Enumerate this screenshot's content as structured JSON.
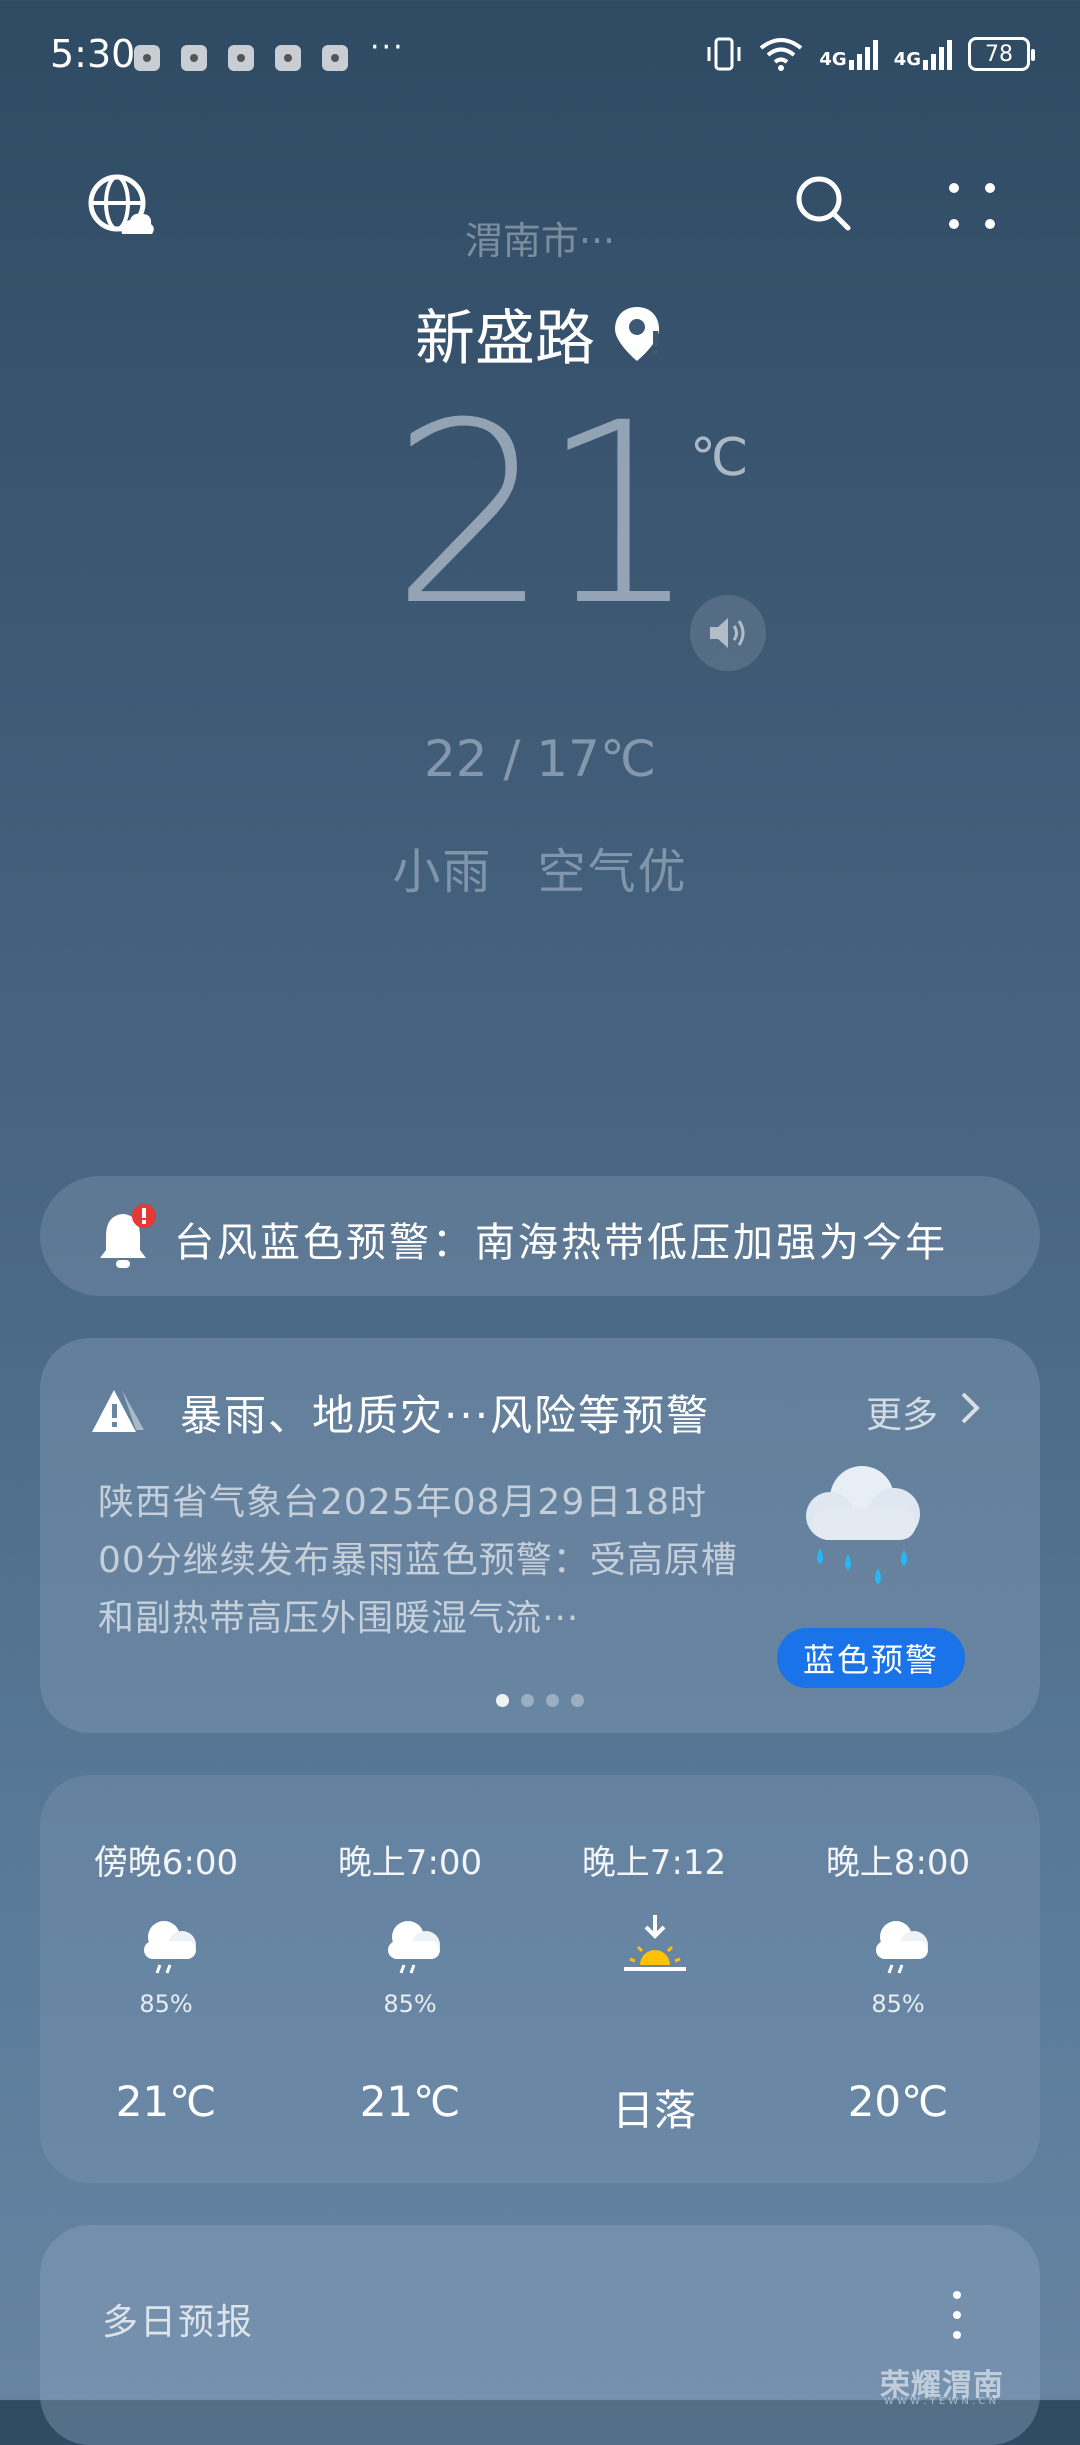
{
  "status_bar": {
    "time": "5:30",
    "more": "···",
    "net1": "4G",
    "net2": "4G",
    "battery": "78"
  },
  "header": {
    "district": "渭南市···",
    "location": "新盛路"
  },
  "current": {
    "temp": "21",
    "unit": "℃",
    "hilo": "22 / 17℃",
    "condition": "小雨",
    "air": "空气优"
  },
  "ticker": {
    "text": "台风蓝色预警：南海热带低压加强为今年"
  },
  "alert": {
    "title": "暴雨、地质灾···风险等预警",
    "more_label": "更多",
    "body": "陕西省气象台2025年08月29日18时00分继续发布暴雨蓝色预警：受高原槽和副热带高压外围暖湿气流···",
    "level_label": "蓝色预警",
    "pages": 4,
    "active_page": 0
  },
  "hourly": [
    {
      "time": "傍晚6:00",
      "icon": "rain-cloud-icon",
      "prob": "85%",
      "temp": "21℃"
    },
    {
      "time": "晚上7:00",
      "icon": "rain-cloud-icon",
      "prob": "85%",
      "temp": "21℃"
    },
    {
      "time": "晚上7:12",
      "icon": "sunset-icon",
      "prob": "",
      "temp": "日落"
    },
    {
      "time": "晚上8:00",
      "icon": "rain-cloud-icon",
      "prob": "85%",
      "temp": "20℃"
    }
  ],
  "multiday": {
    "title": "多日预报"
  },
  "watermark": {
    "text": "荣耀渭南",
    "sub": "W W W . Y E W N . C N"
  },
  "colors": {
    "alert_level_bg": "#1a73e8",
    "alert_badge": "#e53935"
  }
}
